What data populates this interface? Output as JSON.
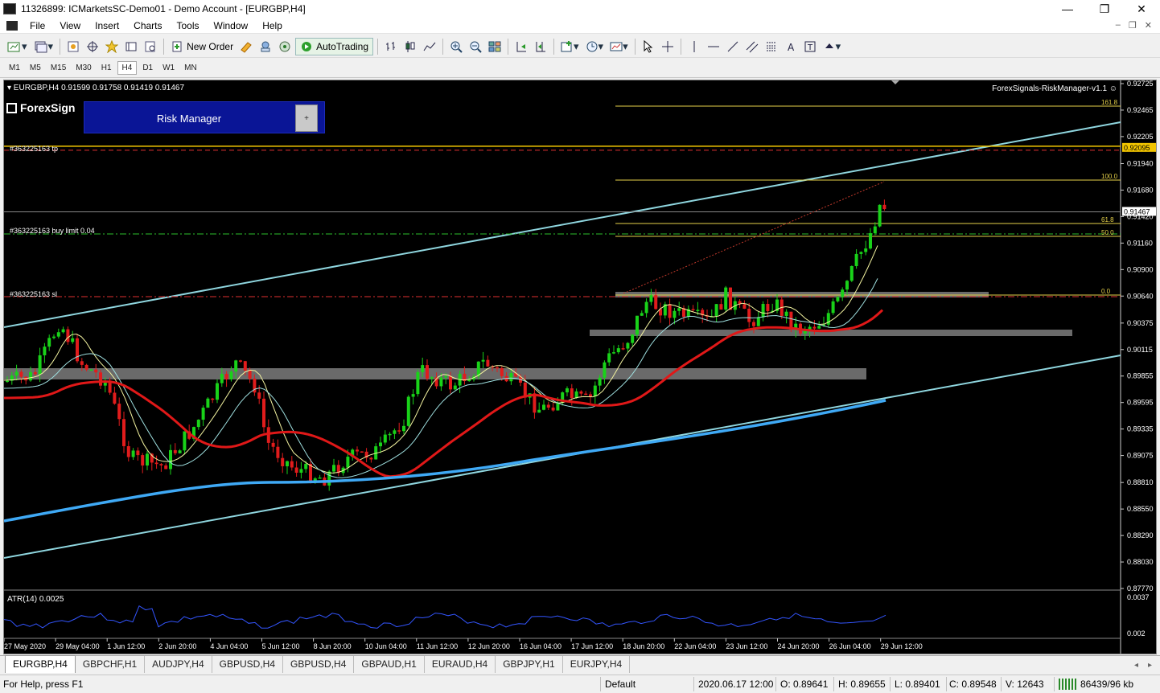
{
  "window": {
    "title": "11326899: ICMarketsSC-Demo01 - Demo Account - [EURGBP,H4]",
    "minimize": "—",
    "restore": "❐",
    "close": "✕"
  },
  "menu": [
    "File",
    "View",
    "Insert",
    "Charts",
    "Tools",
    "Window",
    "Help"
  ],
  "mdi_controls": [
    "–",
    "❐",
    "✕"
  ],
  "toolbar": {
    "new_order": "New Order",
    "autotrading": "AutoTrading"
  },
  "timeframes": [
    "M1",
    "M5",
    "M15",
    "M30",
    "H1",
    "H4",
    "D1",
    "W1",
    "MN"
  ],
  "active_timeframe": "H4",
  "chart": {
    "ohlc_label": "▾ EURGBP,H4  0.91599 0.91758 0.91419 0.91467",
    "ea_label": "ForexSignals-RiskManager-v1.1 ☺",
    "logo_text": "ForexSign",
    "risk_manager_title": "Risk Manager",
    "risk_manager_plus": "+",
    "order_tp_label": "#363225163 tp",
    "order_buy_label": "#363225163 buy limit 0.04",
    "order_sl_label": "#363225163 sl",
    "atr_label": "ATR(14) 0.0025",
    "price_axis": [
      "0.92725",
      "0.92465",
      "0.92205",
      "0.91940",
      "0.91680",
      "0.91420",
      "0.91160",
      "0.90900",
      "0.90640",
      "0.90375",
      "0.90115",
      "0.89855",
      "0.89595",
      "0.89335",
      "0.89075",
      "0.88810",
      "0.88550",
      "0.88290",
      "0.88030",
      "0.87770"
    ],
    "atr_axis": [
      "0.0037",
      "0.002"
    ],
    "price_markers": {
      "tp": "0.92095",
      "current": "0.91467"
    },
    "fib_labels": [
      "161.8",
      "100.0",
      "61.8",
      "50.0",
      "0.0"
    ],
    "time_axis": [
      "27 May 2020",
      "29 May 04:00",
      "1 Jun 12:00",
      "2 Jun 20:00",
      "4 Jun 04:00",
      "5 Jun 12:00",
      "8 Jun 20:00",
      "10 Jun 04:00",
      "11 Jun 12:00",
      "12 Jun 20:00",
      "16 Jun 04:00",
      "17 Jun 12:00",
      "18 Jun 20:00",
      "22 Jun 04:00",
      "23 Jun 12:00",
      "24 Jun 20:00",
      "26 Jun 04:00",
      "29 Jun 12:00"
    ],
    "colors": {
      "bull": "#19d219",
      "bear": "#e11c1c",
      "ma_slow": "#3fa9f5",
      "ma_mid": "#e01818",
      "channel": "#8fd6df",
      "fib": "#e6d24a",
      "tp": "#f2c500",
      "sl": "#e03030",
      "atr": "#3355ff"
    }
  },
  "chart_tabs": [
    "EURGBP,H4",
    "GBPCHF,H1",
    "AUDJPY,H4",
    "GBPUSD,H4",
    "GBPUSD,H4",
    "GBPAUD,H1",
    "EURAUD,H4",
    "GBPJPY,H1",
    "EURJPY,H4"
  ],
  "active_tab": "EURGBP,H4",
  "tab_nav": [
    "◂",
    "▸"
  ],
  "status": {
    "help": "For Help, press F1",
    "profile": "Default",
    "datetime": "2020.06.17 12:00",
    "open": "O: 0.89641",
    "high": "H: 0.89655",
    "low": "L: 0.89401",
    "close": "C: 0.89548",
    "volume": "V: 12643",
    "traffic": "86439/96 kb"
  }
}
